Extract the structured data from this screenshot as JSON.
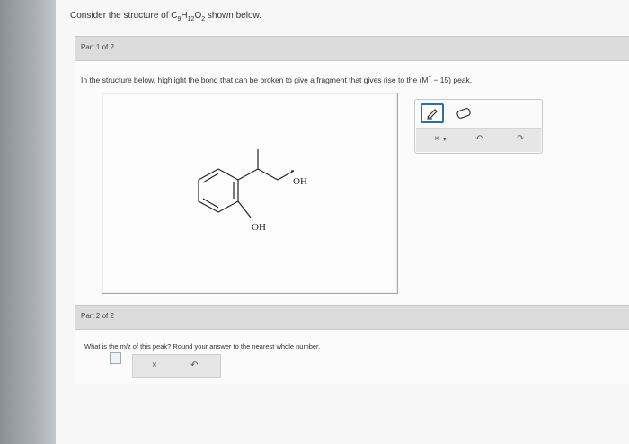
{
  "question": {
    "prefix": "Consider the structure of ",
    "formula_parts": [
      "C",
      "9",
      "H",
      "12",
      "O",
      "2"
    ],
    "suffix": " shown below."
  },
  "part1": {
    "label": "Part 1 of 2",
    "instruction_prefix": "In the structure below, highlight the bond that can be broken to give a fragment that gives rise to the (M",
    "instruction_sup": "+",
    "instruction_suffix": " − 15) peak.",
    "molecule": {
      "oh_top": "OH",
      "oh_bottom": "OH"
    },
    "tools": {
      "highlight_icon": "highlighter-icon",
      "eraser_icon": "eraser-icon",
      "clear": "×",
      "clear_dropdown": "▾",
      "undo": "↶",
      "redo": "↷"
    }
  },
  "part2": {
    "label": "Part 2 of 2",
    "question": "What is the m/z of this peak? Round your answer to the nearest whole number.",
    "answer_value": "",
    "tools": {
      "clear": "×",
      "undo": "↶"
    }
  }
}
